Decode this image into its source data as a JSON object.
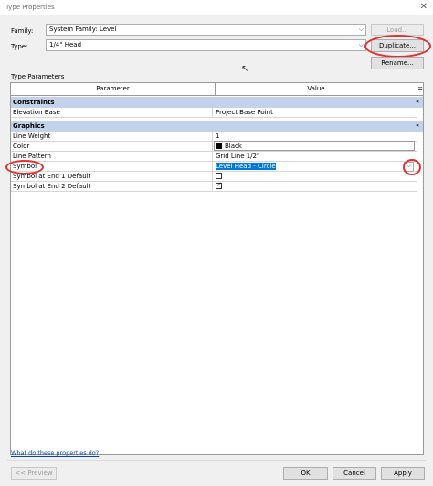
{
  "window": {
    "title": "Type Properties"
  },
  "family": {
    "label": "Family:",
    "value": "System Family: Level",
    "load_label": "Load..."
  },
  "type": {
    "label": "Type:",
    "value": "1/4\" Head",
    "duplicate_label": "Duplicate...",
    "rename_label": "Rename..."
  },
  "type_parameters_label": "Type Parameters",
  "grid": {
    "headers": {
      "parameter": "Parameter",
      "value": "Value",
      "extra": "="
    },
    "groups": [
      {
        "name": "Constraints",
        "collapse": "«",
        "rows": [
          {
            "parameter": "Elevation Base",
            "value": "Project Base Point"
          }
        ]
      },
      {
        "name": "Graphics",
        "collapse": "«",
        "rows": [
          {
            "parameter": "Line Weight",
            "value": "1"
          },
          {
            "parameter": "Color",
            "value": "Black"
          },
          {
            "parameter": "Line Pattern",
            "value": "Grid Line 1/2\""
          },
          {
            "parameter": "Symbol",
            "value": "Level Head - Circle"
          },
          {
            "parameter": "Symbol at End 1 Default",
            "value": "",
            "checked": false
          },
          {
            "parameter": "Symbol at End 2 Default",
            "value": "",
            "checked": true
          }
        ]
      }
    ]
  },
  "help_link": "What do these properties do?",
  "footer": {
    "preview_label": "<< Preview",
    "ok_label": "OK",
    "cancel_label": "Cancel",
    "apply_label": "Apply"
  },
  "colors": {
    "group_bg": "#c1d2ea",
    "selection": "#0078d7",
    "annotation_red": "#e52e2e",
    "link": "#0645ad"
  },
  "icons": {
    "dropdown": "chevron-down-icon",
    "collapse": "collapse-icon",
    "close": "close-icon"
  }
}
